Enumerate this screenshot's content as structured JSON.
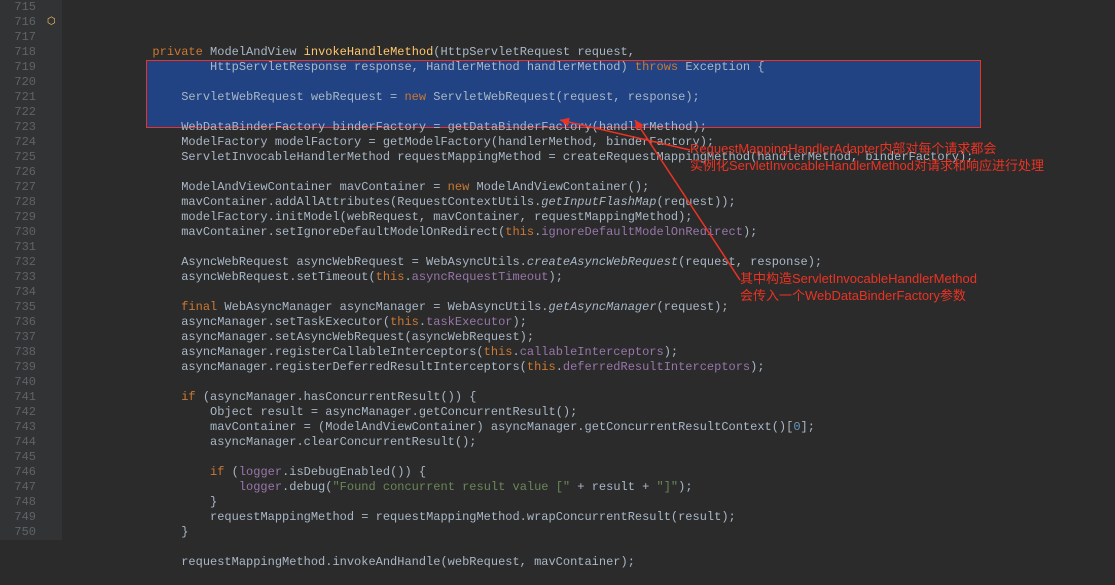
{
  "lineStart": 715,
  "lineEnd": 750,
  "code": [
    {
      "indent": 1,
      "tokens": [
        [
          "kw",
          "private"
        ],
        [
          "",
          ""
        ],
        [
          "type",
          " ModelAndView "
        ],
        [
          "fn",
          "invokeHandleMethod"
        ],
        [
          "",
          "(HttpServletRequest request,"
        ]
      ]
    },
    {
      "indent": 3,
      "tokens": [
        [
          "",
          "HttpServletResponse response, HandlerMethod handlerMethod) "
        ],
        [
          "kw",
          "throws"
        ],
        [
          "",
          " Exception {"
        ]
      ]
    },
    {
      "indent": 0,
      "tokens": []
    },
    {
      "indent": 2,
      "tokens": [
        [
          "",
          "ServletWebRequest webRequest = "
        ],
        [
          "kw",
          "new"
        ],
        [
          "",
          " ServletWebRequest(request, response);"
        ]
      ]
    },
    {
      "indent": 0,
      "tokens": []
    },
    {
      "indent": 2,
      "tokens": [
        [
          "",
          "WebDataBinderFactory binderFactory = getDataBinderFactory(handlerMethod);"
        ]
      ]
    },
    {
      "indent": 2,
      "tokens": [
        [
          "",
          "ModelFactory modelFactory = getModelFactory(handlerMethod, binderFactory);"
        ]
      ]
    },
    {
      "indent": 2,
      "tokens": [
        [
          "",
          "ServletInvocableHandlerMethod requestMappingMethod = createRequestMappingMethod(handlerMethod, binderFactory);"
        ]
      ]
    },
    {
      "indent": 0,
      "tokens": []
    },
    {
      "indent": 2,
      "tokens": [
        [
          "",
          "ModelAndViewContainer mavContainer = "
        ],
        [
          "kw",
          "new"
        ],
        [
          "",
          " ModelAndViewContainer();"
        ]
      ]
    },
    {
      "indent": 2,
      "tokens": [
        [
          "",
          "mavContainer.addAllAttributes(RequestContextUtils."
        ],
        [
          "static",
          "getInputFlashMap"
        ],
        [
          "",
          "(request));"
        ]
      ]
    },
    {
      "indent": 2,
      "tokens": [
        [
          "",
          "modelFactory.initModel(webRequest, mavContainer, requestMappingMethod);"
        ]
      ]
    },
    {
      "indent": 2,
      "tokens": [
        [
          "",
          "mavContainer.setIgnoreDefaultModelOnRedirect("
        ],
        [
          "kw",
          "this"
        ],
        [
          "",
          "."
        ],
        [
          "field",
          "ignoreDefaultModelOnRedirect"
        ],
        [
          "",
          ");"
        ]
      ]
    },
    {
      "indent": 0,
      "tokens": []
    },
    {
      "indent": 2,
      "tokens": [
        [
          "",
          "AsyncWebRequest asyncWebRequest = WebAsyncUtils."
        ],
        [
          "static",
          "createAsyncWebRequest"
        ],
        [
          "",
          "(request, response);"
        ]
      ]
    },
    {
      "indent": 2,
      "tokens": [
        [
          "",
          "asyncWebRequest.setTimeout("
        ],
        [
          "kw",
          "this"
        ],
        [
          "",
          "."
        ],
        [
          "field",
          "asyncRequestTimeout"
        ],
        [
          "",
          ");"
        ]
      ]
    },
    {
      "indent": 0,
      "tokens": []
    },
    {
      "indent": 2,
      "tokens": [
        [
          "kw",
          "final"
        ],
        [
          "",
          " WebAsyncManager asyncManager = WebAsyncUtils."
        ],
        [
          "static",
          "getAsyncManager"
        ],
        [
          "",
          "(request);"
        ]
      ]
    },
    {
      "indent": 2,
      "tokens": [
        [
          "",
          "asyncManager.setTaskExecutor("
        ],
        [
          "kw",
          "this"
        ],
        [
          "",
          "."
        ],
        [
          "field",
          "taskExecutor"
        ],
        [
          "",
          ");"
        ]
      ]
    },
    {
      "indent": 2,
      "tokens": [
        [
          "",
          "asyncManager.setAsyncWebRequest(asyncWebRequest);"
        ]
      ]
    },
    {
      "indent": 2,
      "tokens": [
        [
          "",
          "asyncManager.registerCallableInterceptors("
        ],
        [
          "kw",
          "this"
        ],
        [
          "",
          "."
        ],
        [
          "field",
          "callableInterceptors"
        ],
        [
          "",
          ");"
        ]
      ]
    },
    {
      "indent": 2,
      "tokens": [
        [
          "",
          "asyncManager.registerDeferredResultInterceptors("
        ],
        [
          "kw",
          "this"
        ],
        [
          "",
          "."
        ],
        [
          "field",
          "deferredResultInterceptors"
        ],
        [
          "",
          ");"
        ]
      ]
    },
    {
      "indent": 0,
      "tokens": []
    },
    {
      "indent": 2,
      "tokens": [
        [
          "kw",
          "if"
        ],
        [
          "",
          " (asyncManager.hasConcurrentResult()) {"
        ]
      ]
    },
    {
      "indent": 3,
      "tokens": [
        [
          "",
          "Object result = asyncManager.getConcurrentResult();"
        ]
      ]
    },
    {
      "indent": 3,
      "tokens": [
        [
          "",
          "mavContainer = (ModelAndViewContainer) asyncManager.getConcurrentResultContext()["
        ],
        [
          "num",
          "0"
        ],
        [
          "",
          "];"
        ]
      ]
    },
    {
      "indent": 3,
      "tokens": [
        [
          "",
          "asyncManager.clearConcurrentResult();"
        ]
      ]
    },
    {
      "indent": 0,
      "tokens": []
    },
    {
      "indent": 3,
      "tokens": [
        [
          "kw",
          "if"
        ],
        [
          "",
          " ("
        ],
        [
          "field",
          "logger"
        ],
        [
          "",
          ".isDebugEnabled()) {"
        ]
      ]
    },
    {
      "indent": 4,
      "tokens": [
        [
          "field",
          "logger"
        ],
        [
          "",
          ".debug("
        ],
        [
          "str",
          "\"Found concurrent result value [\""
        ],
        [
          "",
          " + result + "
        ],
        [
          "str",
          "\"]\""
        ],
        [
          "",
          ");"
        ]
      ]
    },
    {
      "indent": 3,
      "tokens": [
        [
          "",
          "}"
        ]
      ]
    },
    {
      "indent": 3,
      "tokens": [
        [
          "",
          "requestMappingMethod = requestMappingMethod.wrapConcurrentResult(result);"
        ]
      ]
    },
    {
      "indent": 2,
      "tokens": [
        [
          "",
          "}"
        ]
      ]
    },
    {
      "indent": 0,
      "tokens": []
    },
    {
      "indent": 2,
      "tokens": [
        [
          "",
          "requestMappingMethod.invokeAndHandle(webRequest, mavContainer);"
        ]
      ]
    },
    {
      "indent": 0,
      "tokens": []
    }
  ],
  "annotations": {
    "box_lines": "720-722",
    "note1_line1": "RequestMappingHandlerAdapter内部对每个请求都会",
    "note1_line2": "实例化ServletInvocableHandlerMethod对请求和响应进行处理",
    "note2_line1": "其中构造ServletInvocableHandlerMethod",
    "note2_line2": "会传入一个WebDataBinderFactory参数"
  },
  "markers": {
    "line716_icon": "override-marker"
  }
}
